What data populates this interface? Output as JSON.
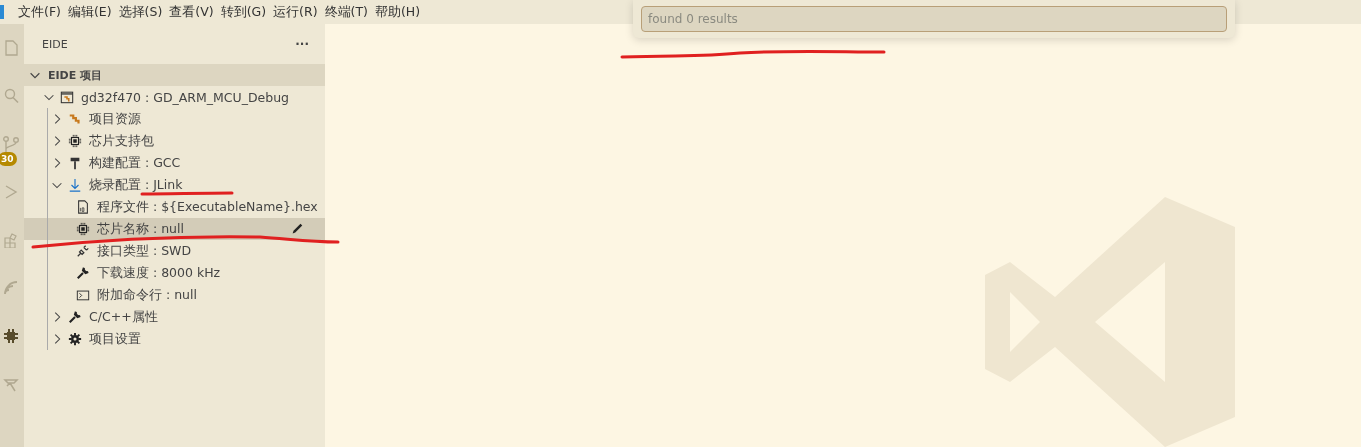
{
  "menu_bar": {
    "items": [
      "文件(F)",
      "编辑(E)",
      "选择(S)",
      "查看(V)",
      "转到(G)",
      "运行(R)",
      "终端(T)",
      "帮助(H)"
    ]
  },
  "activity_bar": {
    "items": [
      {
        "kind": "files",
        "selected": false
      },
      {
        "kind": "search",
        "selected": false
      },
      {
        "kind": "source-control",
        "selected": false,
        "badge": "30"
      },
      {
        "kind": "run",
        "selected": false
      },
      {
        "kind": "extensions",
        "selected": false
      },
      {
        "kind": "remote",
        "selected": false
      },
      {
        "kind": "chip",
        "selected": true
      },
      {
        "kind": "tools",
        "selected": false
      }
    ]
  },
  "sidebar": {
    "title": "EIDE",
    "more": "···",
    "section": {
      "title": "EIDE 项目",
      "expanded": true
    },
    "tree": [
      {
        "label": "gd32f470 : GD_ARM_MCU_Debug",
        "kind": "project",
        "expanded": true,
        "selected": false,
        "children": [
          {
            "label": "项目资源",
            "kind": "resources",
            "expanded": false,
            "selected": false
          },
          {
            "label": "芯片支持包",
            "kind": "chip",
            "expanded": false,
            "selected": false
          },
          {
            "label": "构建配置 : GCC",
            "kind": "hammer",
            "expanded": false,
            "selected": false
          },
          {
            "label": "烧录配置 : JLink",
            "kind": "download",
            "expanded": true,
            "selected": false,
            "children": [
              {
                "label": "程序文件 : ${ExecutableName}.hex",
                "kind": "binary",
                "selected": false
              },
              {
                "label": "芯片名称 : null",
                "kind": "chip",
                "selected": true
              },
              {
                "label": "接口类型 : SWD",
                "kind": "plug",
                "selected": false
              },
              {
                "label": "下载速度 : 8000 kHz",
                "kind": "wrench",
                "selected": false
              },
              {
                "label": "附加命令行 : null",
                "kind": "terminal",
                "selected": false
              }
            ]
          },
          {
            "label": "C/C++属性",
            "kind": "wrench",
            "expanded": false,
            "selected": false
          },
          {
            "label": "项目设置",
            "kind": "gear",
            "expanded": false,
            "selected": false
          }
        ]
      }
    ]
  },
  "search_widget": {
    "placeholder": "found 0 results"
  },
  "pen_marks": [
    {
      "color": "#e02020"
    },
    {
      "color": "#e02020"
    },
    {
      "color": "#e02020"
    }
  ]
}
